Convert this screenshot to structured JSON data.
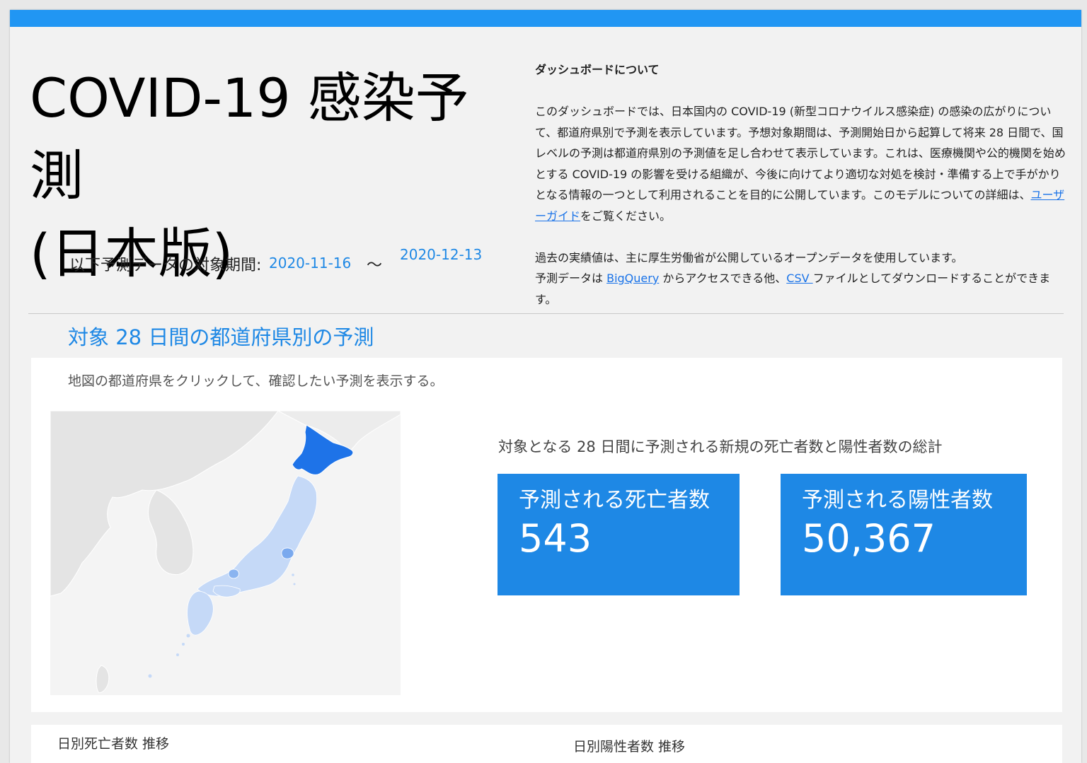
{
  "header": {
    "title_line1": "COVID-19 感染予測",
    "title_line2": "(日本版)",
    "accent_color": "#2196f3"
  },
  "period": {
    "label": "以下予測データの対象期間:",
    "start_date": "2020-11-16",
    "separator": "～",
    "end_date": "2020-12-13"
  },
  "about": {
    "heading": "ダッシュボードについて",
    "paragraph1_text": "このダッシュボードでは、日本国内の COVID-19 (新型コロナウイルス感染症) の感染の広がりについて、都道府県別で予測を表示しています。予想対象期間は、予測開始日から起算して将来 28 日間で、国レベルの予測は都道府県別の予測値を足し合わせて表示しています。これは、医療機関や公的機関を始めとする COVID-19 の影響を受ける組織が、今後に向けてより適切な対処を検討・準備する上で手がかりとなる情報の一つとして利用されることを目的に公開しています。このモデルについての詳細は、",
    "user_guide_link": "ユーザーガイド",
    "paragraph1_suffix": "をご覧ください。",
    "paragraph2_line1": "過去の実績値は、主に厚生労働省が公開しているオープンデータを使用しています。",
    "paragraph2_prefix": "予測データは ",
    "bigquery_link": "BigQuery",
    "paragraph2_mid": " からアクセスできる他、",
    "csv_link": "CSV ",
    "paragraph2_suffix": "ファイルとしてダウンロードすることができます。"
  },
  "section": {
    "title": "対象 28 日間の都道府県別の予測",
    "instruction": "地図の都道府県をクリックして、確認したい予測を表示する。"
  },
  "summary": {
    "heading": "対象となる 28 日間に予測される新規の死亡者数と陽性者数の総計",
    "deaths_label": "予測される死亡者数",
    "deaths_value": "543",
    "cases_label": "予測される陽性者数",
    "cases_value": "50,367",
    "card_color": "#1e88e5"
  },
  "charts": {
    "deaths_title": "日別死亡者数 推移",
    "cases_title": "日別陽性者数 推移"
  }
}
